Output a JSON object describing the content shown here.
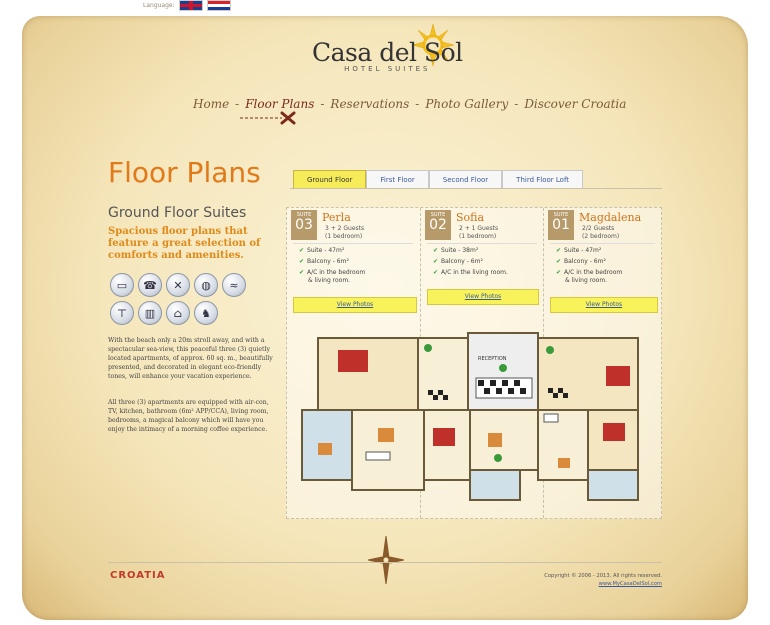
{
  "language": {
    "label": "Language:",
    "flags": [
      "flag-uk-icon",
      "flag-hr-icon"
    ]
  },
  "logo": {
    "title": "Casa del Sol",
    "subtitle": "HOTEL SUITES"
  },
  "nav": [
    {
      "label": "Home"
    },
    {
      "label": "Floor Plans"
    },
    {
      "label": "Reservations"
    },
    {
      "label": "Photo Gallery"
    },
    {
      "label": "Discover Croatia"
    }
  ],
  "nav_sep": "-",
  "page_title": "Floor Plans",
  "tabs": [
    {
      "label": "Ground Floor"
    },
    {
      "label": "First Floor"
    },
    {
      "label": "Second Floor"
    },
    {
      "label": "Third Floor Loft"
    }
  ],
  "section_title": "Ground Floor Suites",
  "tagline": "Spacious floor plans that feature a great selection of comforts and amenities.",
  "amenity_icons": [
    "tv-icon",
    "phone-icon",
    "dining-icon",
    "globe-icon",
    "sea-icon",
    "shirt-icon",
    "heater-icon",
    "garage-icon",
    "pet-icon"
  ],
  "paragraph1": "With the beach only a 20m stroll away, and with a spectacular sea-view, this peaceful three (3) quietly located apartments, of approx. 60 sq. m., beautifully presented, and decorated in elegant eco-friendly tones, will enhance your vacation experience.",
  "paragraph2": "All three (3) apartments are equipped with air-con, TV, kitchen, bathroom (6m² APP/CCA), living room, bedrooms, a magical balcony which will have you enjoy the intimacy of a morning coffee experience.",
  "suites": [
    {
      "badge_word": "SUITE",
      "number": "03",
      "name": "Perla",
      "guests": "3 + 2 Guests",
      "rooms": "(1 bedroom)",
      "features": [
        "Suite - 47m²",
        "Balcony - 6m²",
        "A/C in the bedroom",
        "& living room."
      ],
      "link": "View Photos"
    },
    {
      "badge_word": "SUITE",
      "number": "02",
      "name": "Sofia",
      "guests": "2 + 1 Guests",
      "rooms": "(1 bedroom)",
      "features": [
        "Suite - 38m²",
        "Balcony - 6m²",
        "A/C in the living room."
      ],
      "link": "View Photos"
    },
    {
      "badge_word": "SUITE",
      "number": "01",
      "name": "Magdalena",
      "guests": "2/2 Guests",
      "rooms": "(2 bedroom)",
      "features": [
        "Suite - 47m²",
        "Balcony - 6m²",
        "A/C in the bedroom",
        "& living room."
      ],
      "link": "View Photos"
    }
  ],
  "floorplan": {
    "reception_label": "RECEPTION"
  },
  "footer": {
    "croatia_logo": "CROATIA",
    "copyright": "Copyright © 2006 - 2013. All rights reserved.",
    "site_link": "www.MyCasaDelSol.com"
  },
  "colors": {
    "accent_orange": "#e07a1a",
    "tab_active": "#f6ec5a",
    "link_blue": "#3a5a9a"
  }
}
